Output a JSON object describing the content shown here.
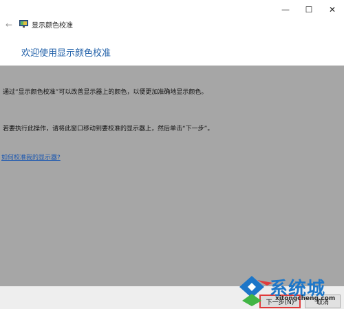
{
  "window": {
    "title": "显示颜色校准",
    "controls": {
      "minimize": "—",
      "maximize": "☐",
      "close": "✕"
    },
    "back_icon": "back-arrow-icon",
    "app_icon": "display-calibration-icon"
  },
  "page": {
    "heading": "欢迎使用显示颜色校准",
    "paragraph_1": "通过“显示颜色校准”可以改善显示器上的颜色，以便更加准确地显示颜色。",
    "paragraph_2": "若要执行此操作，请将此窗口移动到要校准的显示器上，然后单击“下一步”。",
    "help_link": "如何校准我的显示器?"
  },
  "footer": {
    "next_label": "下一步(N)",
    "cancel_label": "取消"
  },
  "watermark": {
    "text": "系统城",
    "url": "xitongcheng.com"
  },
  "colors": {
    "heading_blue": "#1f5fa8",
    "link_blue": "#1b57b0",
    "overlay_gray": "#a6a6a6",
    "highlight_red": "#e03b3b"
  }
}
